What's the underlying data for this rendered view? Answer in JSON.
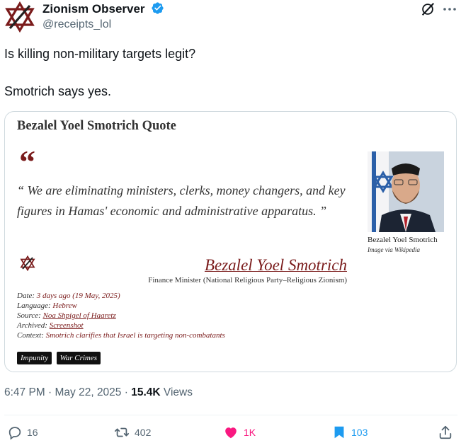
{
  "author": {
    "name": "Zionism Observer",
    "handle": "@receipts_lol"
  },
  "tweet": {
    "line1": "Is killing non-military targets legit?",
    "line2": "Smotrich says yes."
  },
  "card": {
    "title": "Bezalel Yoel Smotrich Quote",
    "quote_mark": "“",
    "quote": "“ We are eliminating ministers, clerks, money changers, and key figures in Hamas' economic and administrative apparatus. ”",
    "photo_caption": "Bezalel Yoel Smotrich",
    "photo_source": "Image via Wikipedia",
    "speaker": "Bezalel Yoel Smotrich",
    "speaker_role": "Finance Minister (National Religious Party–Religious Zionism)",
    "meta": {
      "date_label": "Date:",
      "date_value": "3 days ago (19 May, 2025)",
      "language_label": "Language:",
      "language_value": "Hebrew",
      "source_label": "Source:",
      "source_value": "Noa Shpigel of Haaretz",
      "archived_label": "Archived:",
      "archived_value": "Screenshot",
      "context_label": "Context:",
      "context_value": "Smotrich clarifies that Israel is targeting non-combatants"
    },
    "tags": [
      "Impunity",
      "War Crimes"
    ]
  },
  "timestamp": {
    "time": "6:47 PM · May 22, 2025 · ",
    "views_count": "15.4K",
    "views_label": " Views"
  },
  "actions": {
    "reply_count": "16",
    "retweet_count": "402",
    "like_count": "1K",
    "view_count": "103"
  },
  "colors": {
    "accent": "#1d9bf0",
    "like": "#f91880",
    "quote_red": "#7a1b1b",
    "muted": "#536471"
  }
}
